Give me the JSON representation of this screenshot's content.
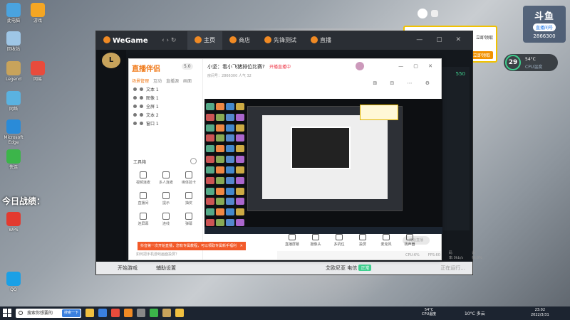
{
  "desktop": {
    "big_label": "今日战绩：",
    "icons": [
      {
        "label": "此电脑",
        "color": "#4aa3df"
      },
      {
        "label": "回收站",
        "color": "#9ec6e6"
      },
      {
        "label": "Legend",
        "color": "#c8a35b"
      },
      {
        "label": "网络",
        "color": "#5ab2e0"
      },
      {
        "label": "Microsoft Edge",
        "color": "#2a8bd8"
      },
      {
        "label": "快连",
        "color": "#3cb54a"
      },
      {
        "label": "WPS",
        "color": "#e33a2f"
      },
      {
        "label": "游戏",
        "color": "#f5a623"
      },
      {
        "label": "网易",
        "color": "#e84b3c"
      },
      {
        "label": "QQ",
        "color": "#1aa0e6"
      }
    ]
  },
  "widgets": {
    "douyu_logo": "斗鱼",
    "douyu_pill": "直播间号",
    "douyu_room": "2866300",
    "gauge_value": "29",
    "gauge_temp": "54°C",
    "gauge_label": "CPU温度",
    "notif_btn1": "立即领取",
    "notif_btn2": "立即领取"
  },
  "wegame": {
    "logo": "WeGame",
    "nav": "‹ ›  ↻",
    "tabs": [
      {
        "label": "主页",
        "active": true
      },
      {
        "label": "商店",
        "active": false
      },
      {
        "label": "先锋测试",
        "active": false
      },
      {
        "label": "直播",
        "active": false
      }
    ],
    "win_controls": "— ▢ ✕",
    "sidebar_logo": "L",
    "level": "550",
    "bottom_left": "开始游戏",
    "bottom_settings": "辅助设置",
    "bottom_server": "艾欧尼亚 电信",
    "bottom_badge": "正常",
    "bottom_far": "正在运行..."
  },
  "stream": {
    "logo": "直播伴侣",
    "version": "5.0",
    "left_tabs": [
      "场景管理",
      "互动",
      "直播源",
      "画面"
    ],
    "scenes": [
      {
        "label": "文本 1"
      },
      {
        "label": "图像 1"
      },
      {
        "label": "全屏 1"
      },
      {
        "label": "文本 2"
      },
      {
        "label": "窗口 1"
      }
    ],
    "tools_title": "工具箱",
    "tools": [
      {
        "label": "视频连麦"
      },
      {
        "label": "多人连麦"
      },
      {
        "label": "绑体验卡"
      },
      {
        "label": "直播间"
      },
      {
        "label": "提示"
      },
      {
        "label": "抽奖"
      },
      {
        "label": "连屏幕"
      },
      {
        "label": "连线"
      },
      {
        "label": "弹幕"
      }
    ],
    "tip": "如何把手机游戏画面投屏？",
    "room_title": "小坚：看小飞猪排位比赛?",
    "room_tag": "开播直播中",
    "room_sub": "房间号：2866300  人气  32",
    "toast": "抖音第一次开始直播，您有专属教程，可以领取专属新手福利",
    "toast_close": "✕",
    "win_controls": "— ▢ ✕",
    "top_icons": "⊞ ⊟ ⋯ ⚙",
    "controls": [
      {
        "label": "直播屏幕"
      },
      {
        "label": "摄像头"
      },
      {
        "label": "多机位"
      },
      {
        "label": "投屏"
      },
      {
        "label": "麦克风"
      },
      {
        "label": "扬声器"
      }
    ],
    "go_live": "开始直播",
    "status": [
      "CPU:6%",
      "FPS:60",
      "码率:0kb/s",
      "丢帧:0%"
    ]
  },
  "taskbar": {
    "search_placeholder": "搜索你想要的",
    "search_btn": "搜索一下",
    "app_colors": [
      "#f0c040",
      "#3a80e0",
      "#e84b3c",
      "#f08a24",
      "#888888",
      "#3cb54a",
      "#c8a35b",
      "#f0c040"
    ],
    "cpu_temp": "54°C",
    "cpu_label": "CPU温度",
    "weather": "10°C 多云",
    "time": "23:02",
    "date": "2022/3/31"
  }
}
